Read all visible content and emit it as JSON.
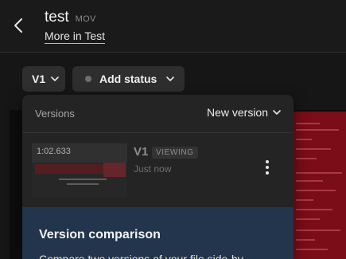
{
  "header": {
    "title": "test",
    "file_type": "MOV",
    "more_link": "More in Test"
  },
  "toolbar": {
    "version_label": "V1",
    "status_label": "Add status"
  },
  "versions_panel": {
    "heading": "Versions",
    "new_version_label": "New version",
    "items": [
      {
        "duration": "1:02.633",
        "version": "V1",
        "badge": "VIEWING",
        "time": "Just now"
      }
    ]
  },
  "comparison": {
    "title": "Version comparison",
    "description": "Compare two versions of your file side-by"
  },
  "colors": {
    "header_bg": "#1a1a1a",
    "chip_bg": "#2e2e2e",
    "panel_bg": "#242424",
    "compare_bg": "#22354c",
    "preview_red": "#7a0d18"
  },
  "icons": [
    "back-arrow-icon",
    "chevron-down-icon",
    "status-dot-icon",
    "kebab-menu-icon"
  ]
}
